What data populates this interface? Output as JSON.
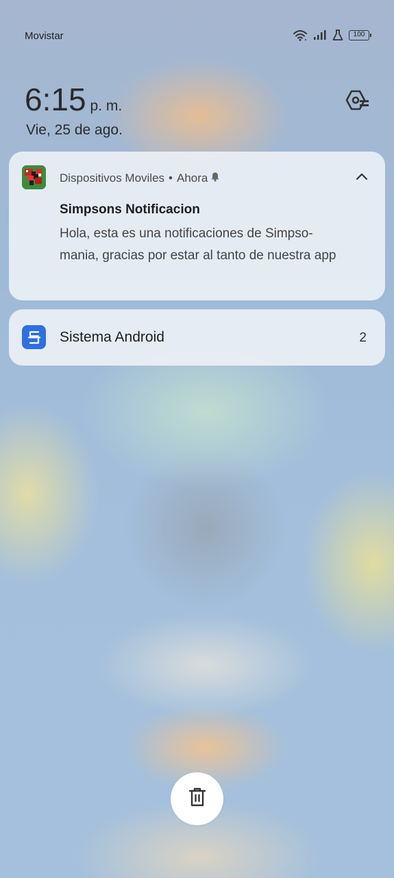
{
  "status_bar": {
    "carrier": "Movistar",
    "battery_level": "100",
    "icons": [
      "wifi-icon",
      "signal-icon",
      "flask-icon",
      "battery-icon"
    ]
  },
  "clock": {
    "time": "6:15",
    "ampm": "p. m.",
    "date": "Vie, 25 de ago."
  },
  "settings": {
    "icon": "notification-settings-icon"
  },
  "notifications": [
    {
      "app_name": "Dispositivos Moviles",
      "separator": "•",
      "time": "Ahora",
      "title": "Simpsons Notificacion",
      "body": "Hola, esta es una notificaciones de Simpso-mania, gracias por estar al tanto de nuestra app",
      "icon": "app-icon",
      "expanded": true
    },
    {
      "app_name": "Sistema Android",
      "count": "2",
      "icon": "android-system-icon"
    }
  ],
  "actions": {
    "clear_icon": "trash-icon"
  },
  "colors": {
    "card_bg": "#f0f3f8",
    "android_icon_bg": "#2f6fe0",
    "app_icon_bg": "#3a8a3a"
  }
}
